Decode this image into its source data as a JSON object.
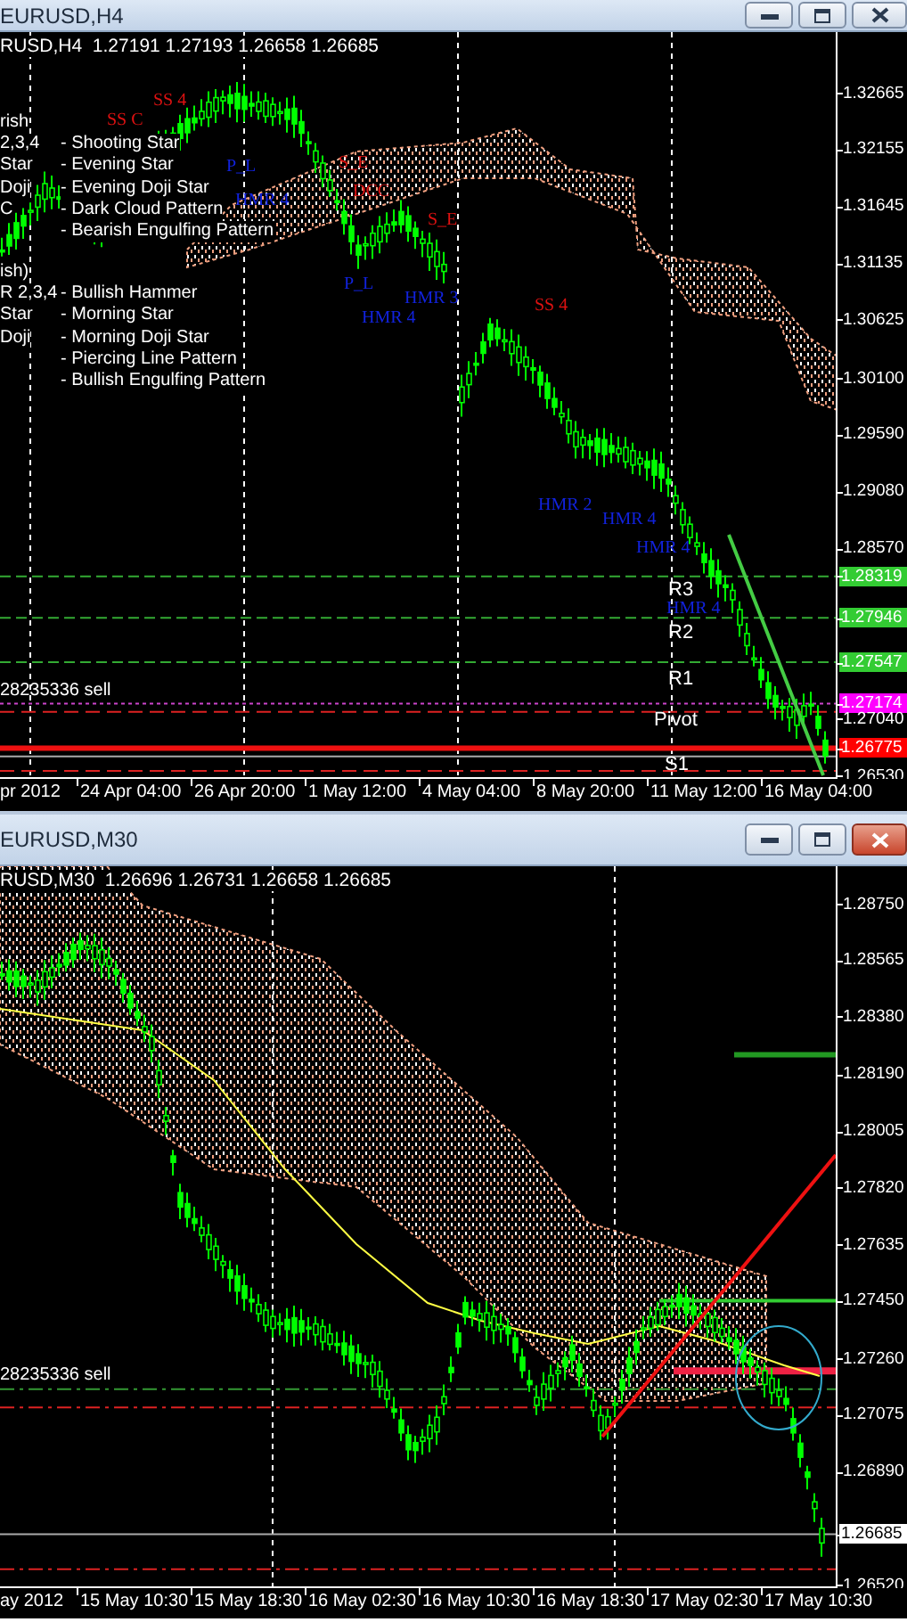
{
  "windows": [
    {
      "title": "EURUSD,H4",
      "active": false,
      "info": "RUSD,H4  1.27191 1.27193 1.26658 1.26685",
      "legend": [
        {
          "heading": "rish",
          "items": [
            {
              "code": "2,3,4",
              "name": "- Shooting Star"
            },
            {
              "code": "Star",
              "name": "- Evening Star"
            },
            {
              "code": "Doji",
              "name": "- Evening Doji Star"
            },
            {
              "code": "C",
              "name": "- Dark Cloud Pattern"
            },
            {
              "name": "- Bearish Engulfing Pattern"
            }
          ]
        },
        {
          "heading": "ish)",
          "items": [
            {
              "code": "R 2,3,4",
              "name": "- Bullish Hammer"
            },
            {
              "code": "Star",
              "name": "- Morning Star"
            },
            {
              "code": "Doji",
              "name": "- Morning Doji Star"
            },
            {
              "name": "- Piercing Line Pattern"
            },
            {
              "name": "- Bullish Engulfing Pattern"
            }
          ]
        }
      ],
      "markers": [
        {
          "text": "SS 4",
          "kind": "bearish"
        },
        {
          "text": "SS C",
          "kind": "bearish"
        },
        {
          "text": "P_L",
          "kind": "bullish"
        },
        {
          "text": "HMR 4",
          "kind": "bullish"
        },
        {
          "text": "S_E",
          "kind": "bearish"
        },
        {
          "text": "DCC",
          "kind": "bearish"
        },
        {
          "text": "S_E",
          "kind": "bearish"
        },
        {
          "text": "P_L",
          "kind": "bullish"
        },
        {
          "text": "HMR 3",
          "kind": "bullish"
        },
        {
          "text": "HMR 4",
          "kind": "bullish"
        },
        {
          "text": "SS 4",
          "kind": "bearish"
        },
        {
          "text": "HMR 2",
          "kind": "bullish"
        },
        {
          "text": "HMR 4",
          "kind": "bullish"
        },
        {
          "text": "HMR 4",
          "kind": "bullish"
        },
        {
          "text": "HMR 4",
          "kind": "bullish"
        }
      ],
      "levels": [
        "R3",
        "R2",
        "R1",
        "Pivot",
        "S1"
      ],
      "order": "28235336 sell",
      "price_labels": [
        {
          "text": "1.32665"
        },
        {
          "text": "1.32155"
        },
        {
          "text": "1.31645"
        },
        {
          "text": "1.31135"
        },
        {
          "text": "1.30625"
        },
        {
          "text": "1.30100"
        },
        {
          "text": "1.29590"
        },
        {
          "text": "1.29080"
        },
        {
          "text": "1.28570"
        },
        {
          "text": "1.28319",
          "color": "#33cc33"
        },
        {
          "text": "1.27946",
          "color": "#33cc33"
        },
        {
          "text": "1.27547",
          "color": "#33cc33"
        },
        {
          "text": "1.27174",
          "color": "#ff00ff"
        },
        {
          "text": "1.27040"
        },
        {
          "text": "1.26775",
          "color": "#ff0000"
        },
        {
          "text": "1.26530"
        }
      ],
      "time_labels": [
        "pr 2012",
        "24 Apr 04:00",
        "26 Apr 20:00",
        "1 May 12:00",
        "4 May 04:00",
        "8 May 20:00",
        "11 May 12:00",
        "16 May 04:00"
      ]
    },
    {
      "title": "EURUSD,M30",
      "active": true,
      "info": "RUSD,M30  1.26696 1.26731 1.26658 1.26685",
      "order": "28235336 sell",
      "price_labels": [
        {
          "text": "1.28750"
        },
        {
          "text": "1.28565"
        },
        {
          "text": "1.28380"
        },
        {
          "text": "1.28190"
        },
        {
          "text": "1.28005"
        },
        {
          "text": "1.27820"
        },
        {
          "text": "1.27635"
        },
        {
          "text": "1.27450"
        },
        {
          "text": "1.27260"
        },
        {
          "text": "1.27075"
        },
        {
          "text": "1.26890"
        },
        {
          "text": "1.26685",
          "color": "#ffffff"
        },
        {
          "text": "1.26520"
        }
      ],
      "time_labels": [
        "ay 2012",
        "15 May 10:30",
        "15 May 18:30",
        "16 May 02:30",
        "16 May 10:30",
        "16 May 18:30",
        "17 May 02:30",
        "17 May 10:30"
      ]
    }
  ]
}
